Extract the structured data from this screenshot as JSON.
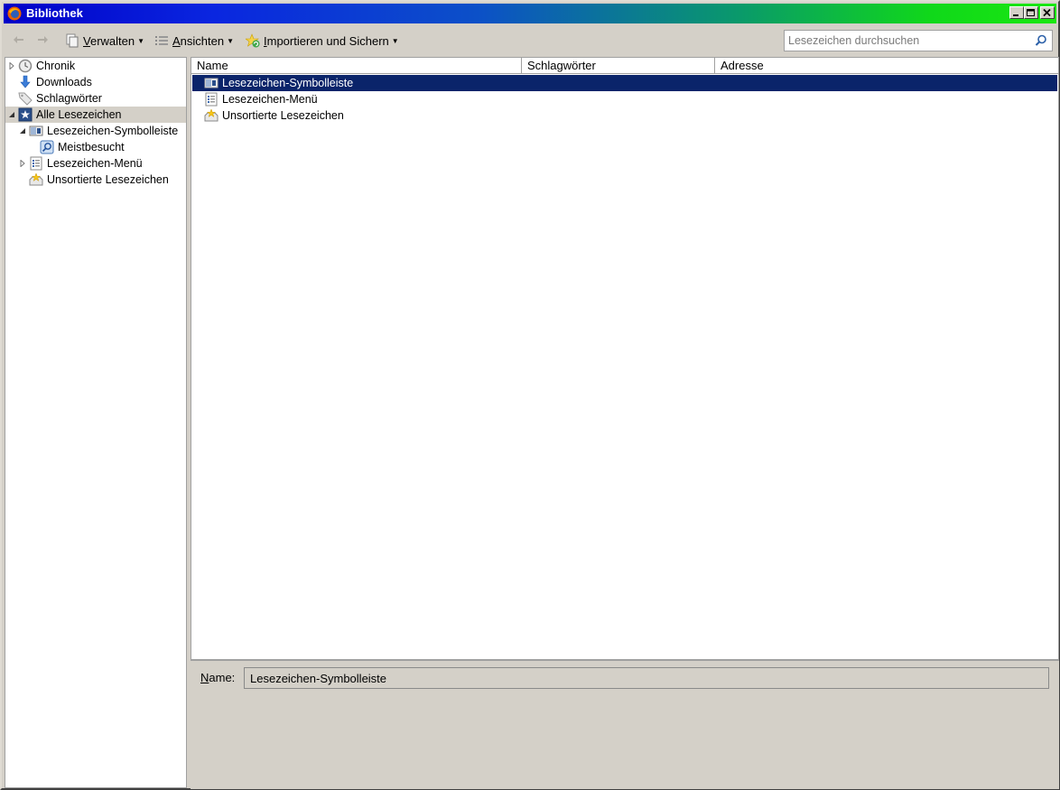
{
  "window": {
    "title": "Bibliothek"
  },
  "toolbar": {
    "organize_label": "Verwalten",
    "organize_key": "V",
    "organize_rest": "erwalten",
    "views_key": "A",
    "views_rest": "nsichten",
    "import_key": "I",
    "import_rest": "mportieren und Sichern",
    "search_placeholder": "Lesezeichen durchsuchen"
  },
  "sidebar": {
    "items": [
      {
        "label": "Chronik",
        "icon": "clock-icon"
      },
      {
        "label": "Downloads",
        "icon": "download-arrow-icon"
      },
      {
        "label": "Schlagwörter",
        "icon": "tag-icon"
      },
      {
        "label": "Alle Lesezeichen",
        "icon": "all-bookmarks-icon",
        "selected": true
      },
      {
        "label": "Lesezeichen-Symbolleiste",
        "icon": "bookmarks-toolbar-icon"
      },
      {
        "label": "Meistbesucht",
        "icon": "smart-folder-icon"
      },
      {
        "label": "Lesezeichen-Menü",
        "icon": "bookmarks-menu-icon"
      },
      {
        "label": "Unsortierte Lesezeichen",
        "icon": "unsorted-bookmarks-icon"
      }
    ]
  },
  "table": {
    "columns": [
      "Name",
      "Schlagwörter",
      "Adresse"
    ],
    "rows": [
      {
        "name": "Lesezeichen-Symbolleiste",
        "selected": true
      },
      {
        "name": "Lesezeichen-Menü"
      },
      {
        "name": "Unsortierte Lesezeichen"
      }
    ]
  },
  "details": {
    "name_label": "Name:",
    "name_key": "N",
    "name_rest": "ame:",
    "name_value": "Lesezeichen-Symbolleiste"
  },
  "colors": {
    "selection": "#0a246a",
    "face": "#d4d0c8"
  }
}
